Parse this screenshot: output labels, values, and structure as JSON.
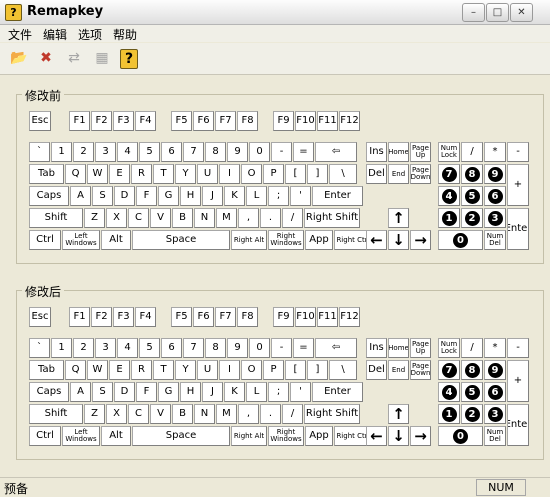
{
  "window": {
    "title": "Remapkey",
    "app_icon": "?",
    "controls": {
      "minimize": "–",
      "maximize": "□",
      "close": "✕"
    }
  },
  "menu": [
    "文件",
    "编辑",
    "选项",
    "帮助"
  ],
  "toolbar": [
    {
      "name": "open-icon",
      "glyph": "📂",
      "enabled": true
    },
    {
      "name": "remove-icon",
      "glyph": "✖",
      "enabled": true
    },
    {
      "name": "remap-icon",
      "glyph": "⇄",
      "enabled": false
    },
    {
      "name": "document-icon",
      "glyph": "▦",
      "enabled": false
    },
    {
      "name": "help-icon",
      "glyph": "?",
      "enabled": true
    }
  ],
  "panels": {
    "before_label": "修改前",
    "after_label": "修改后"
  },
  "keyboard": {
    "esc": "Esc",
    "fkeys": [
      "F1",
      "F2",
      "F3",
      "F4",
      "F5",
      "F6",
      "F7",
      "F8",
      "F9",
      "F10",
      "F11",
      "F12"
    ],
    "row_number": [
      "`",
      "1",
      "2",
      "3",
      "4",
      "5",
      "6",
      "7",
      "8",
      "9",
      "0",
      "-",
      "=",
      "⇦"
    ],
    "row_q": [
      "Tab",
      "Q",
      "W",
      "E",
      "R",
      "T",
      "Y",
      "U",
      "I",
      "O",
      "P",
      "[",
      "]",
      "\\"
    ],
    "row_a": [
      "Caps",
      "A",
      "S",
      "D",
      "F",
      "G",
      "H",
      "J",
      "K",
      "L",
      ";",
      "'",
      "Enter"
    ],
    "row_z": [
      "Shift",
      "Z",
      "X",
      "C",
      "V",
      "B",
      "N",
      "M",
      ",",
      ".",
      "/",
      "Right Shift"
    ],
    "row_bottom": [
      "Ctrl",
      "Left\nWindows",
      "Alt",
      "Space",
      "Right Alt",
      "Right\nWindows",
      "App",
      "Right Ctrl"
    ],
    "nav": [
      "Ins",
      "Home",
      "Page\nUp",
      "Del",
      "End",
      "Page\nDown"
    ],
    "arrows": [
      "↑",
      "←",
      "↓",
      "→"
    ],
    "numpad_top": [
      "Num\nLock",
      "/",
      "*",
      "-"
    ],
    "numpad_digits": [
      "7",
      "8",
      "9",
      "4",
      "5",
      "6",
      "1",
      "2",
      "3"
    ],
    "numpad_plus": "+",
    "numpad_enter": "Enter",
    "numpad_zero": "0",
    "numpad_del": "Num\nDel"
  },
  "status": {
    "text": "预备",
    "num": "NUM"
  }
}
